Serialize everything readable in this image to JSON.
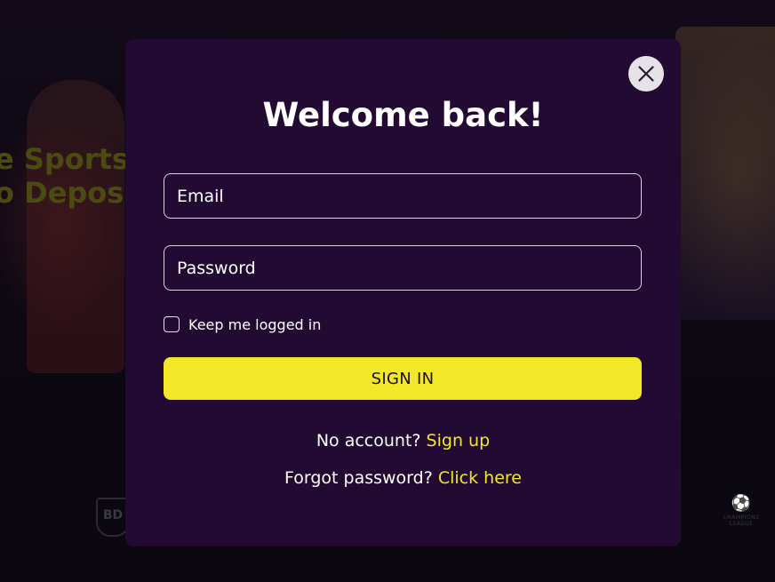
{
  "background": {
    "hero_line1": "e Sports",
    "hero_line2": "o Depos",
    "left_logo": "BD",
    "right_logo_caption": "CHAMPIONS LEAGUE"
  },
  "modal": {
    "title": "Welcome back!",
    "email_placeholder": "Email",
    "password_placeholder": "Password",
    "remember_label": "Keep me logged in",
    "remember_checked": false,
    "signin_label": "SIGN IN",
    "no_account_text": "No account?",
    "signup_link": "Sign up",
    "forgot_text": "Forgot password?",
    "forgot_link": "Click here",
    "close_icon": "close-icon"
  },
  "colors": {
    "modal_bg": "#230a33",
    "accent": "#f3e828",
    "text": "#ffffff"
  }
}
